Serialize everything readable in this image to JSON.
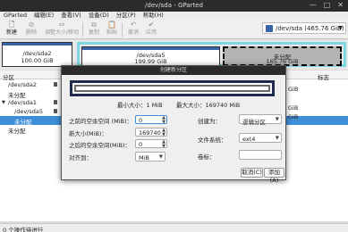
{
  "window": {
    "title": "/dev/sda - GParted"
  },
  "menu": [
    "GParted",
    "编辑(E)",
    "查看(V)",
    "设备(D)",
    "分区(P)",
    "帮助(H)"
  ],
  "toolbar": {
    "new": "新建",
    "delete": "删除",
    "resize": "调整大小/移动",
    "copy": "复制",
    "paste": "粘贴",
    "undo": "撤消",
    "apply": "应用"
  },
  "device": {
    "label": "/dev/sda",
    "size": "(465.76 GiB)"
  },
  "diskmap": [
    {
      "name": "/dev/sda2",
      "size": "100.00 GiB"
    },
    {
      "name": "/dev/sda5",
      "size": "199.99 GiB"
    },
    {
      "name": "未分配",
      "size": "165.76 GiB"
    }
  ],
  "table": {
    "columns": {
      "partition": "分区",
      "flags": "标志"
    },
    "rows": [
      {
        "name": "/dev/sda2",
        "tree": "",
        "locked": true,
        "selected": false
      },
      {
        "name": "未分配",
        "tree": "",
        "locked": false,
        "selected": false
      },
      {
        "name": "/dev/sda1",
        "tree": "▼",
        "locked": true,
        "selected": false
      },
      {
        "name": "/dev/sda5",
        "tree": "",
        "locked": true,
        "selected": false
      },
      {
        "name": "未分配",
        "tree": "",
        "locked": false,
        "selected": true
      },
      {
        "name": "未分配",
        "tree": "",
        "locked": false,
        "selected": false
      }
    ],
    "right_labels": [
      "GiB",
      "GiB",
      "GiB"
    ]
  },
  "dialog": {
    "title": "创建新分区",
    "min_size": "最小大小：1 MiB",
    "max_size": "最大大小：169740 MiB",
    "free_before_label": "之前的空余空间 (MiB)：",
    "free_before_value": "0",
    "new_size_label": "新大小(MiB)：",
    "new_size_value": "169740",
    "free_after_label": "之后的空余空间(MiB)：",
    "free_after_value": "0",
    "align_label": "对齐到：",
    "align_value": "MiB",
    "create_as_label": "创建为：",
    "create_as_value": "逻辑分区",
    "filesystem_label": "文件系统：",
    "filesystem_value": "ext4",
    "volume_label_label": "卷标：",
    "volume_label_value": "",
    "cancel": "取消(C)",
    "add": "添加(A)"
  },
  "status": "0 个操作待进行",
  "colors": {
    "ext4": "#3a64a8",
    "extended": "#7dd8e6",
    "unallocated": "#b4b4b4",
    "selection": "#3e8ed8"
  }
}
